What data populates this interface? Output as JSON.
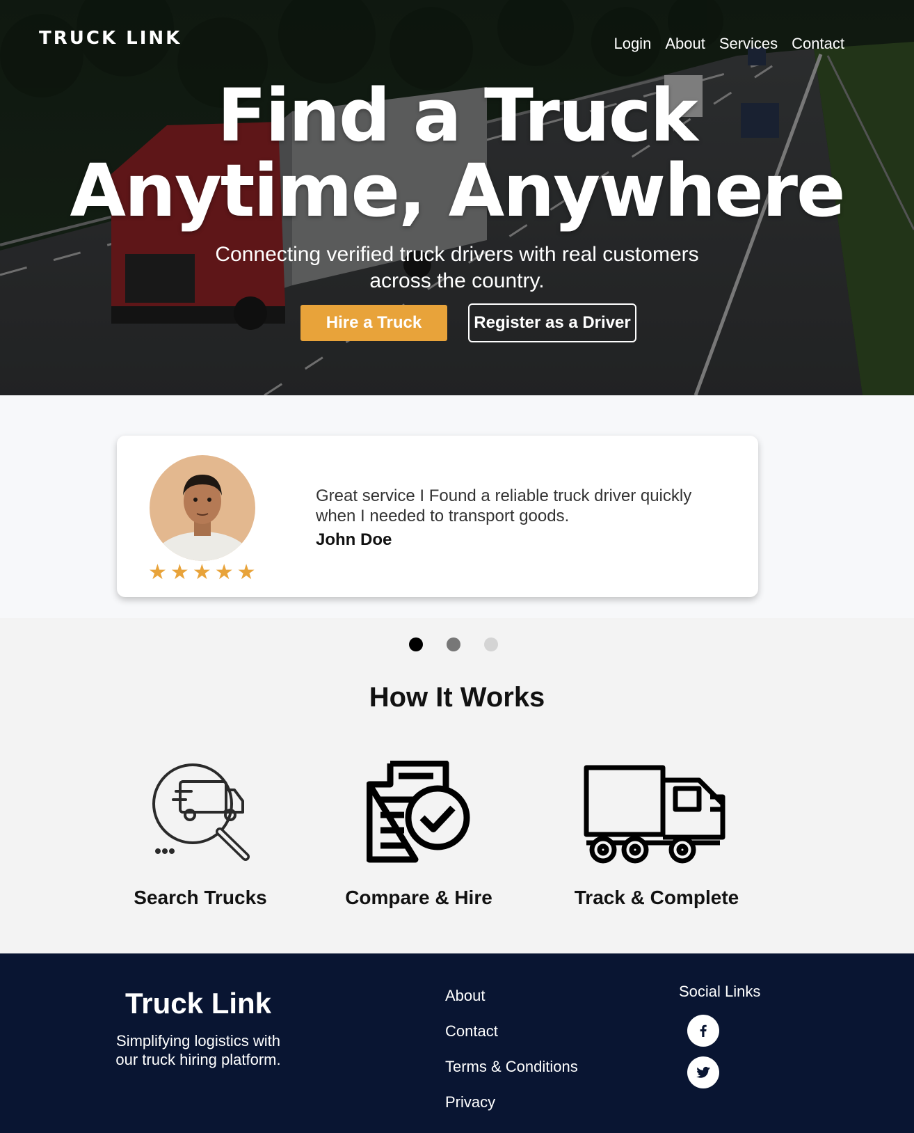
{
  "header": {
    "logo": "TRUCK LINK",
    "nav": [
      "Login",
      "About",
      "Services",
      "Contact"
    ]
  },
  "hero": {
    "title_line1": "Find a Truck",
    "title_line2": "Anytime, Anywhere",
    "subtitle_line1": "Connecting verified truck drivers with real customers",
    "subtitle_line2": "across the country.",
    "primary_button": "Hire a Truck",
    "secondary_button": "Register as a Driver"
  },
  "testimonial": {
    "quote_line1": "Great service I Found a reliable truck driver quickly",
    "quote_line2": "when I needed to transport goods.",
    "author": "John Doe",
    "rating": 5,
    "star_glyph": "★"
  },
  "carousel": {
    "active_index": 0,
    "count": 3
  },
  "how_it_works": {
    "title": "How It Works",
    "steps": [
      {
        "label": "Search Trucks",
        "icon": "truck-search-icon"
      },
      {
        "label": "Compare & Hire",
        "icon": "document-check-icon"
      },
      {
        "label": "Track & Complete",
        "icon": "truck-icon"
      }
    ]
  },
  "footer": {
    "brand": "Truck Link",
    "tagline_line1": "Simplifying logistics with",
    "tagline_line2": "our truck hiring platform.",
    "links": [
      "About",
      "Contact",
      "Terms & Conditions",
      "Privacy"
    ],
    "social_title": "Social Links",
    "social": [
      "facebook-icon",
      "twitter-icon"
    ]
  },
  "colors": {
    "accent": "#e8a33a",
    "footer_bg": "#091532",
    "section_bg": "#f3f3f3",
    "dot_active": "#000000",
    "dot_mid": "#777777",
    "dot_inactive": "#d4d4d4"
  }
}
